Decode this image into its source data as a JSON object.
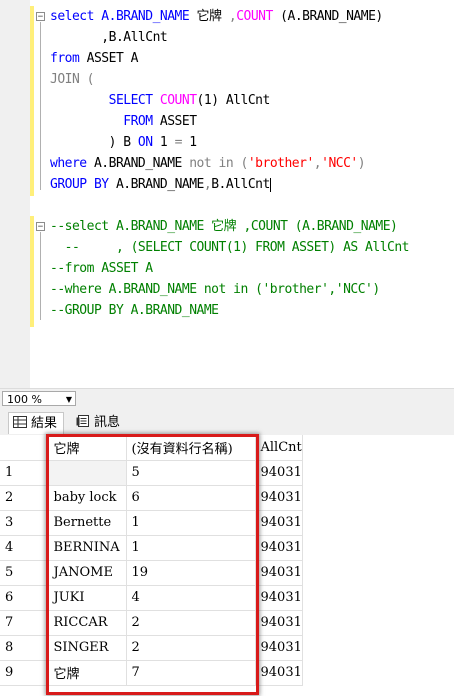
{
  "editor": {
    "block1": {
      "l1": {
        "a": "select A.BRAND_NAME ",
        "b": "它牌 ",
        "c": ",",
        "d": "COUNT",
        "e": " (A.BRAND_NAME)"
      },
      "l2": {
        "a": "       ,B.AllCnt"
      },
      "l3": {
        "a": "from",
        "b": " ASSET A"
      },
      "l4": {
        "a": "JOIN ("
      },
      "l5": {
        "a": "        SELECT ",
        "b": "COUNT",
        "c": "(1) AllCnt"
      },
      "l6": {
        "a": "          FROM",
        "b": " ASSET"
      },
      "l7": {
        "a": "        ) B ",
        "b": "ON",
        "c": " 1 ",
        "d": "=",
        "e": " 1"
      },
      "l8": {
        "a": "where",
        "b": " A.BRAND_NAME ",
        "c": "not in",
        "d": " (",
        "e": "'brother'",
        "f": ",",
        "g": "'NCC'",
        "h": ")"
      },
      "l9": {
        "a": "GROUP BY",
        "b": " A.BRAND_NAME",
        "c": ",",
        "d": "B.AllCnt"
      }
    },
    "block2": {
      "l1": "--select A.BRAND_NAME 它牌 ,COUNT (A.BRAND_NAME)",
      "l2": "  --     , (SELECT COUNT(1) FROM ASSET) AS AllCnt",
      "l3": "--from ASSET A",
      "l4": "--where A.BRAND_NAME not in ('brother','NCC')",
      "l5": "--GROUP BY A.BRAND_NAME"
    }
  },
  "zoom": {
    "value": "100 %"
  },
  "tabs": {
    "results": "結果",
    "messages": "訊息"
  },
  "grid": {
    "headers": [
      "它牌",
      "(沒有資料行名稱)",
      "AllCnt"
    ],
    "rows": [
      {
        "n": "1",
        "a": "",
        "b": "5",
        "c": "94031"
      },
      {
        "n": "2",
        "a": "baby lock",
        "b": "6",
        "c": "94031"
      },
      {
        "n": "3",
        "a": "Bernette",
        "b": "1",
        "c": "94031"
      },
      {
        "n": "4",
        "a": "BERNINA",
        "b": "1",
        "c": "94031"
      },
      {
        "n": "5",
        "a": "JANOME",
        "b": "19",
        "c": "94031"
      },
      {
        "n": "6",
        "a": "JUKI",
        "b": "4",
        "c": "94031"
      },
      {
        "n": "7",
        "a": "RICCAR",
        "b": "2",
        "c": "94031"
      },
      {
        "n": "8",
        "a": "SINGER",
        "b": "2",
        "c": "94031"
      },
      {
        "n": "9",
        "a": "它牌",
        "b": "7",
        "c": "94031"
      }
    ]
  },
  "colors": {
    "highlight_box": "#d81a1a",
    "keyword": "#0000ff",
    "function": "#ff00ff",
    "string": "#ff0000",
    "comment": "#008000"
  }
}
